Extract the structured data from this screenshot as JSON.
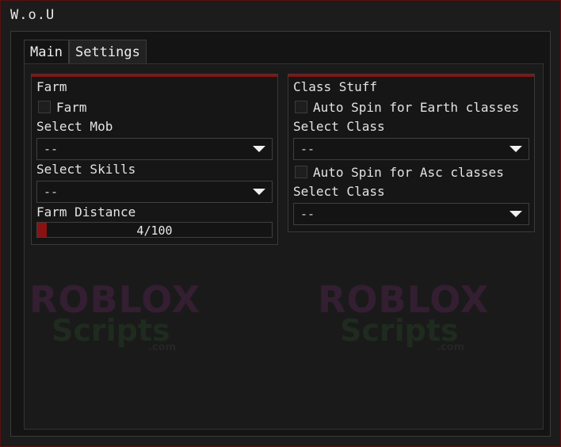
{
  "window": {
    "title": "W.o.U"
  },
  "tabs": [
    {
      "label": "Main",
      "active": true
    },
    {
      "label": "Settings",
      "active": false
    }
  ],
  "farm": {
    "header": "Farm",
    "farm_checkbox": {
      "label": "Farm",
      "checked": false
    },
    "select_mob": {
      "label": "Select Mob",
      "value": "--"
    },
    "select_skills": {
      "label": "Select Skills",
      "value": "--"
    },
    "farm_distance": {
      "label": "Farm Distance",
      "value": 4,
      "max": 100,
      "text": "4/100"
    }
  },
  "class_stuff": {
    "header": "Class Stuff",
    "earth_checkbox": {
      "label": "Auto Spin for Earth classes",
      "checked": false
    },
    "select_class_1": {
      "label": "Select Class",
      "value": "--"
    },
    "asc_checkbox": {
      "label": "Auto Spin for Asc classes",
      "checked": false
    },
    "select_class_2": {
      "label": "Select Class",
      "value": "--"
    }
  },
  "watermark": {
    "line1": "ROBLOX",
    "line2": "Scripts",
    "line3": ".com"
  },
  "colors": {
    "accent": "#8a1212",
    "background": "#1c1c1c",
    "panel": "#161616"
  }
}
